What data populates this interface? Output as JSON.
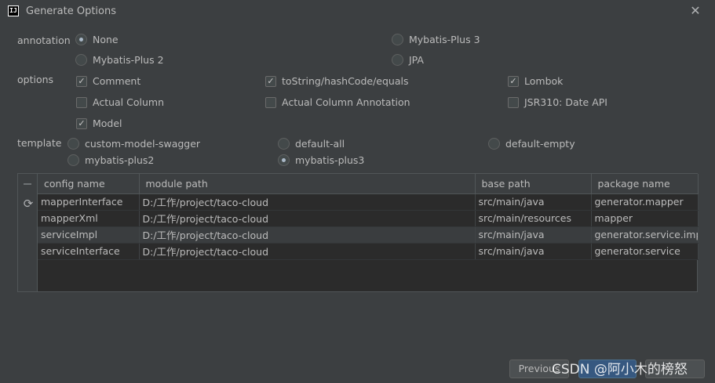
{
  "window": {
    "title": "Generate Options",
    "app_icon": "IJ"
  },
  "annotation": {
    "label": "annotation",
    "options": [
      "None",
      "Mybatis-Plus 3",
      "Mybatis-Plus 2",
      "JPA"
    ],
    "selected": "None"
  },
  "options": {
    "label": "options",
    "items": [
      {
        "label": "Comment",
        "checked": true
      },
      {
        "label": "toString/hashCode/equals",
        "checked": true
      },
      {
        "label": "Lombok",
        "checked": true
      },
      {
        "label": "Actual Column",
        "checked": false
      },
      {
        "label": "Actual Column Annotation",
        "checked": false
      },
      {
        "label": "JSR310: Date API",
        "checked": false
      },
      {
        "label": "Model",
        "checked": true
      }
    ]
  },
  "template": {
    "label": "template",
    "options": [
      "custom-model-swagger",
      "default-all",
      "default-empty",
      "mybatis-plus2",
      "mybatis-plus3"
    ],
    "selected": "mybatis-plus3"
  },
  "table": {
    "columns": [
      "config name",
      "module path",
      "base path",
      "package name"
    ],
    "rows": [
      [
        "mapperInterface",
        "D:/工作/project/taco-cloud",
        "src/main/java",
        "generator.mapper"
      ],
      [
        "mapperXml",
        "D:/工作/project/taco-cloud",
        "src/main/resources",
        "mapper"
      ],
      [
        "serviceImpl",
        "D:/工作/project/taco-cloud",
        "src/main/java",
        "generator.service.impl"
      ],
      [
        "serviceInterface",
        "D:/工作/project/taco-cloud",
        "src/main/java",
        "generator.service"
      ]
    ]
  },
  "buttons": {
    "previous": "Previous"
  },
  "watermark": "CSDN @阿小木的榜怒",
  "icons": {
    "close": "close-icon",
    "refresh": "refresh-icon",
    "remove": "minus-icon"
  }
}
